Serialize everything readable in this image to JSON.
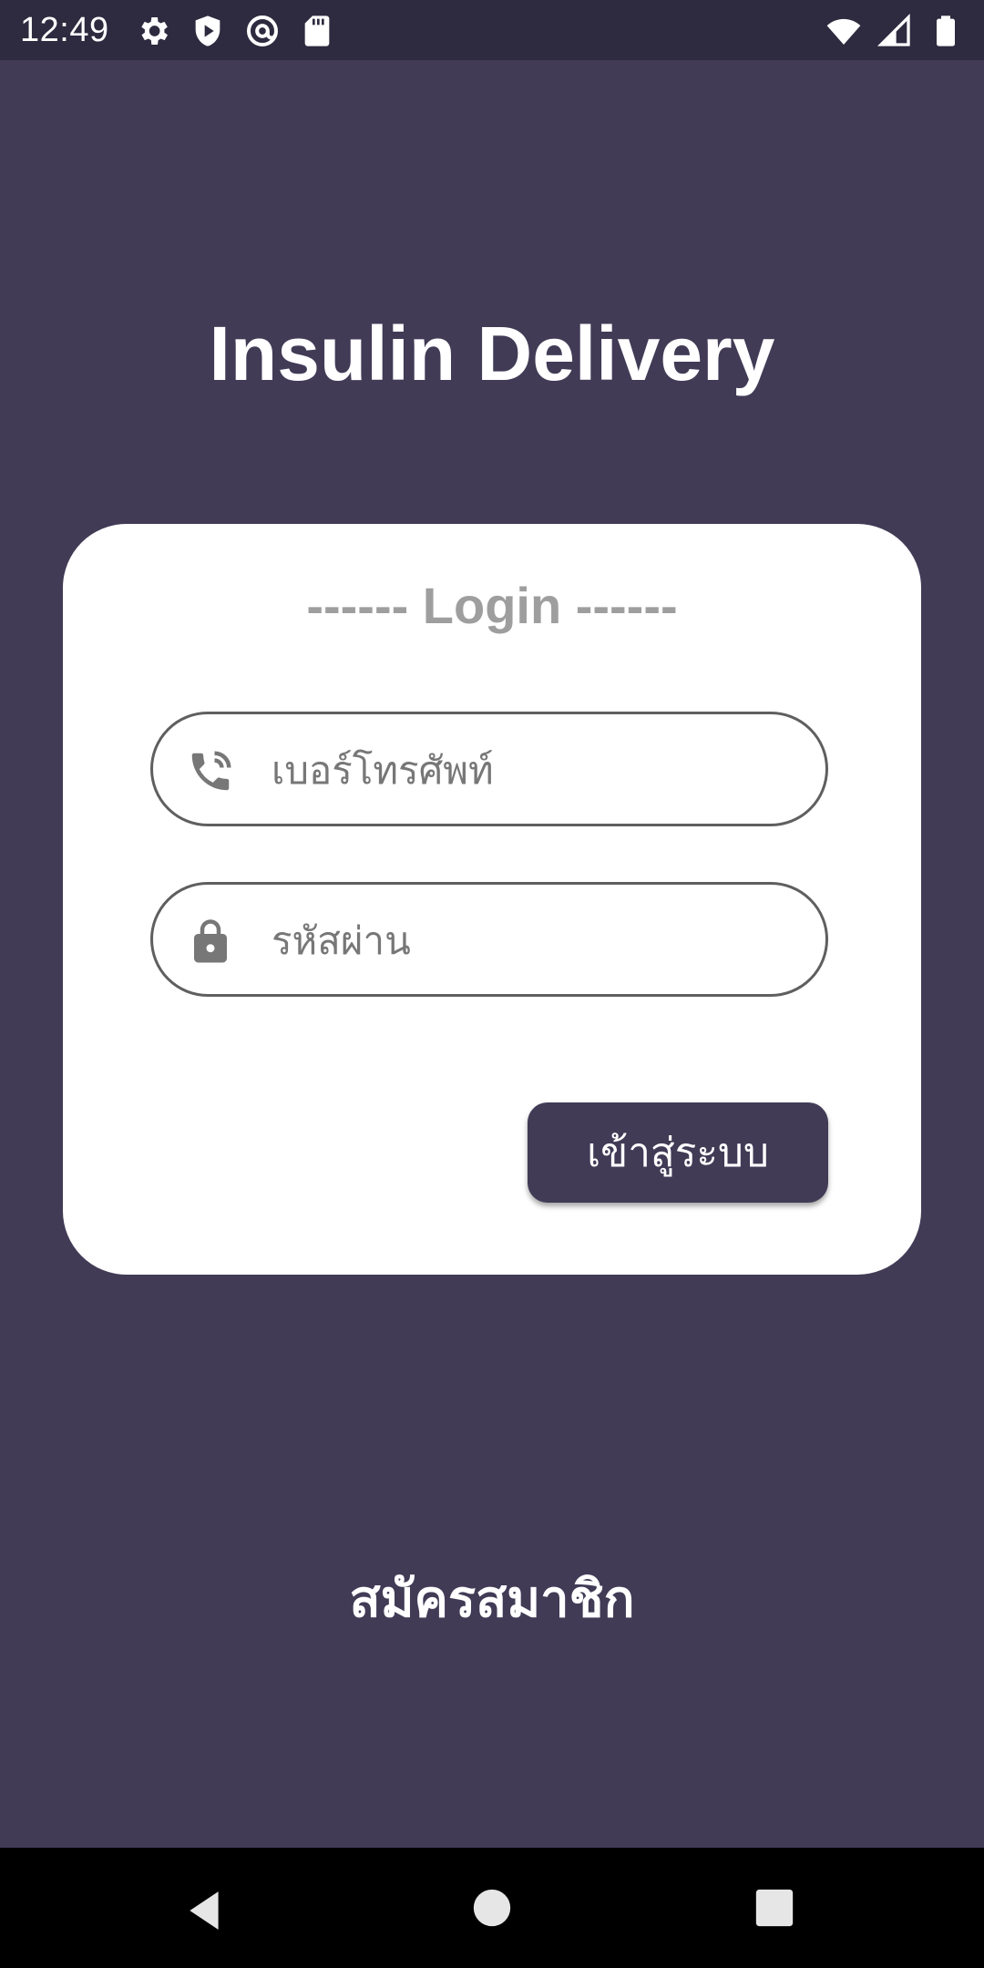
{
  "status_bar": {
    "time": "12:49",
    "icons_left": [
      "gear-icon",
      "shield-icon",
      "at-sign-icon",
      "sd-card-icon"
    ],
    "icons_right": [
      "wifi-icon",
      "signal-icon",
      "battery-icon"
    ]
  },
  "app": {
    "title": "Insulin Delivery"
  },
  "login_card": {
    "heading": "------ Login ------",
    "phone_field": {
      "placeholder": "เบอร์โทรศัพท์",
      "value": "",
      "icon": "phone-icon"
    },
    "password_field": {
      "placeholder": "รหัสผ่าน",
      "value": "",
      "icon": "lock-icon"
    },
    "login_button_label": "เข้าสู่ระบบ"
  },
  "register_link_label": "สมัครสมาชิก",
  "nav_bar": {
    "icons": [
      "back-icon",
      "home-icon",
      "recents-icon"
    ]
  },
  "colors": {
    "background": "#413b56",
    "card": "#ffffff",
    "button": "#413b56",
    "heading_text": "#9e9e9e"
  }
}
